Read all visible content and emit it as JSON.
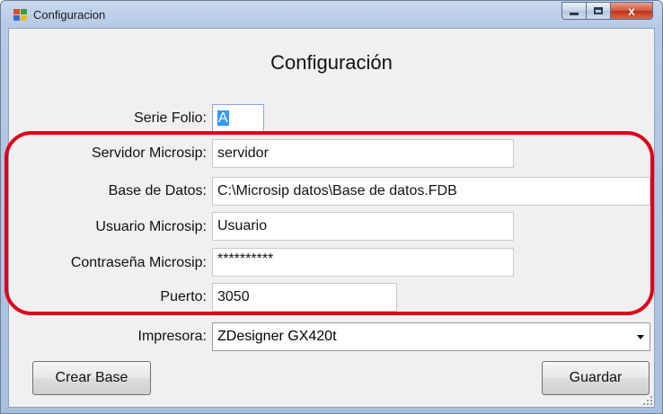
{
  "window": {
    "title": "Configuracion",
    "controls": {
      "minimize": "minimize",
      "maximize": "maximize",
      "close": "x"
    }
  },
  "form": {
    "heading": "Configuración",
    "serie_folio": {
      "label": "Serie Folio:",
      "value": "A"
    },
    "servidor": {
      "label": "Servidor Microsip:",
      "value": "servidor"
    },
    "base_datos": {
      "label": "Base de Datos:",
      "value": "C:\\Microsip datos\\Base de datos.FDB"
    },
    "usuario": {
      "label": "Usuario Microsip:",
      "value": "Usuario"
    },
    "contrasena": {
      "label": "Contraseña Microsip:",
      "value": "**********"
    },
    "puerto": {
      "label": "Puerto:",
      "value": "3050"
    },
    "impresora": {
      "label": "Impresora:",
      "value": "ZDesigner GX420t"
    }
  },
  "buttons": {
    "crear_base": "Crear Base",
    "guardar": "Guardar"
  },
  "colors": {
    "highlight": "#e0001a",
    "selection": "#3399ff",
    "client_background": "#f0f0f0"
  }
}
